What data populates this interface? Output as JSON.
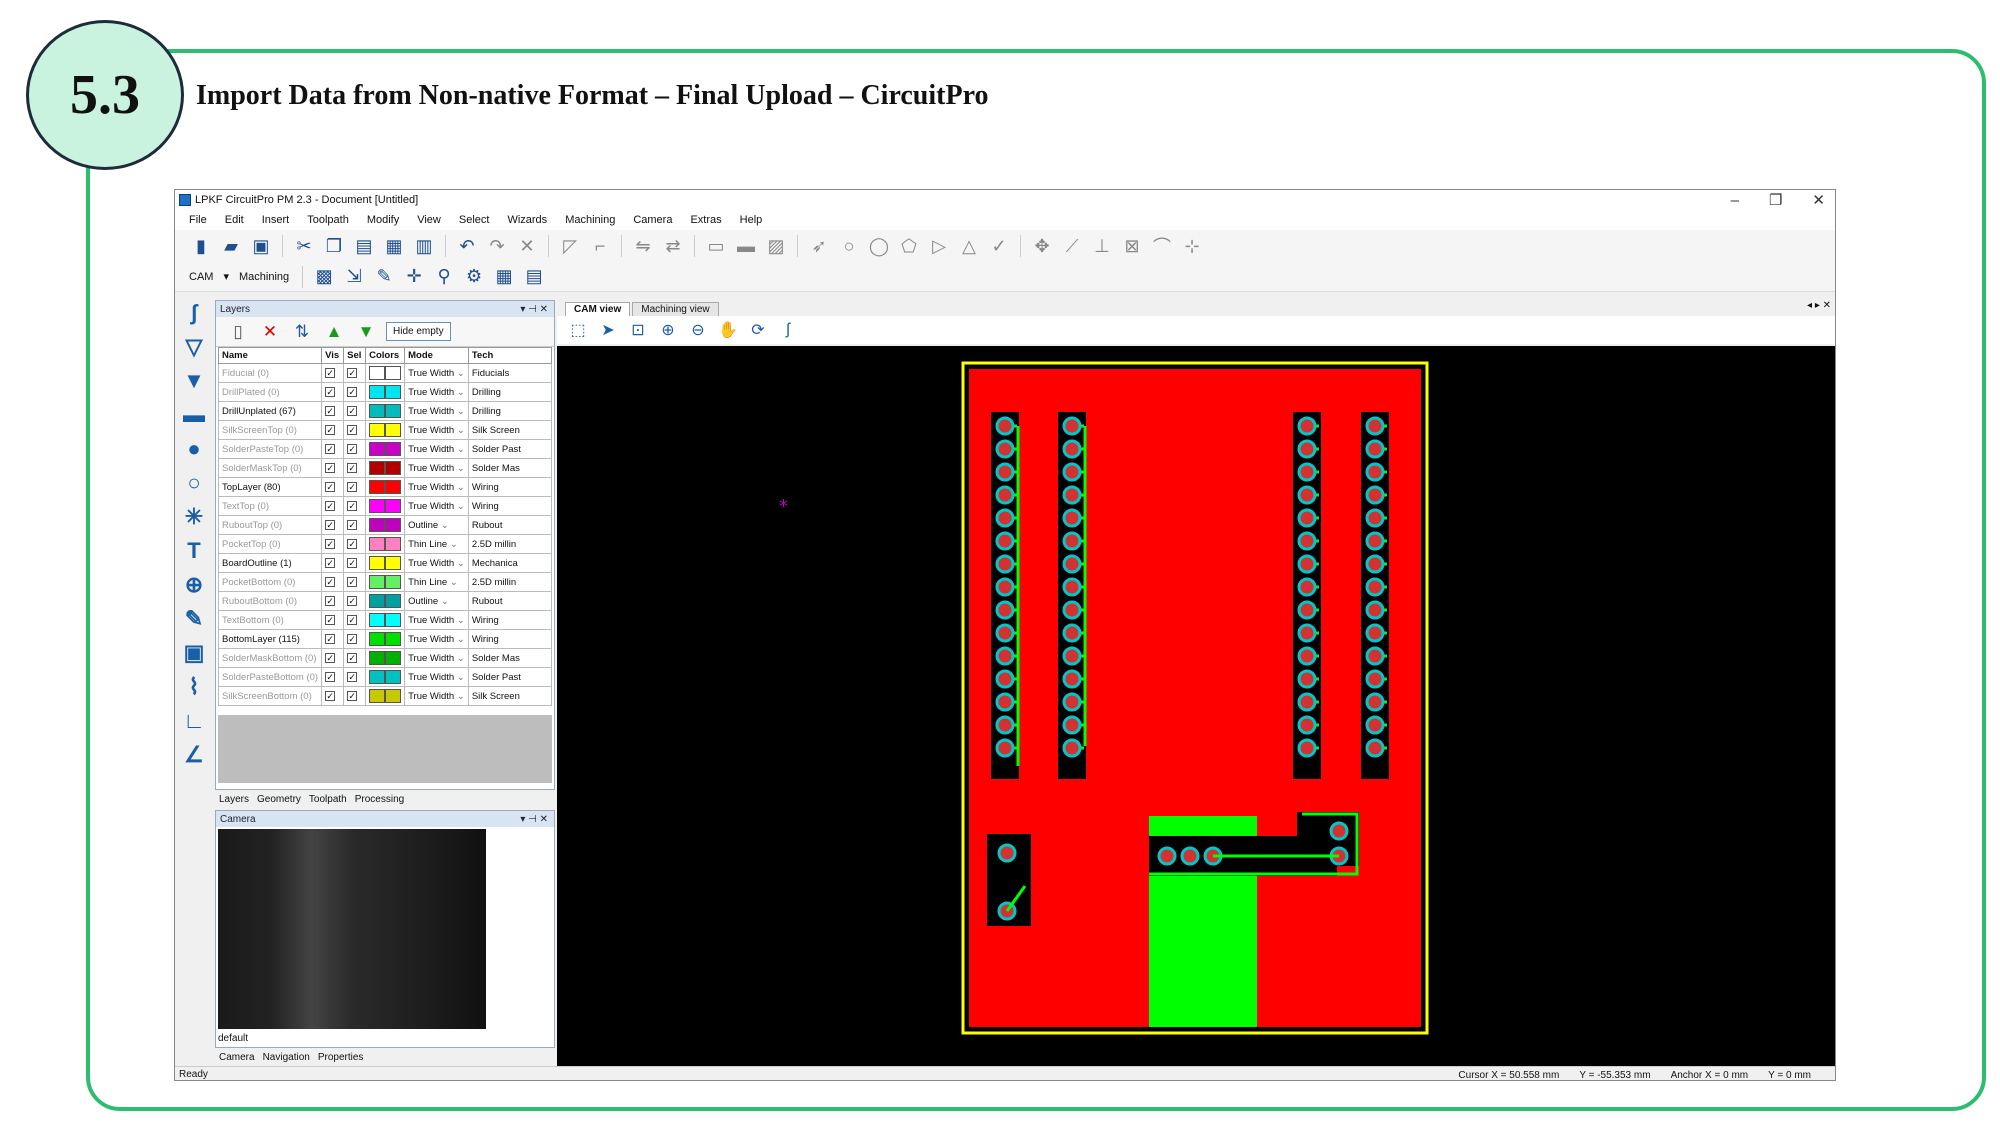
{
  "slide": {
    "badge": "5.3",
    "title": "Import Data from Non-native Format – Final Upload – CircuitPro"
  },
  "app": {
    "window_title": "LPKF CircuitPro PM 2.3 - Document [Untitled]",
    "menu": [
      "File",
      "Edit",
      "Insert",
      "Toolpath",
      "Modify",
      "View",
      "Select",
      "Wizards",
      "Machining",
      "Camera",
      "Extras",
      "Help"
    ],
    "toolbar2": {
      "mode_label": "CAM",
      "mode_value": "Machining"
    }
  },
  "layers_panel": {
    "title": "Layers",
    "hide_empty": "Hide empty",
    "columns": [
      "Name",
      "Vis",
      "Sel",
      "Colors",
      "Mode",
      "Tech"
    ],
    "rows": [
      {
        "name": "Fiducial (0)",
        "color": "#ffffff",
        "mode": "True Width",
        "tech": "Fiducials",
        "dim": true
      },
      {
        "name": "DrillPlated (0)",
        "color": "#00e5ee",
        "mode": "True Width",
        "tech": "Drilling",
        "dim": true
      },
      {
        "name": "DrillUnplated (67)",
        "color": "#00bcbc",
        "mode": "True Width",
        "tech": "Drilling",
        "dim": false
      },
      {
        "name": "SilkScreenTop (0)",
        "color": "#ffff00",
        "mode": "True Width",
        "tech": "Silk Screen",
        "dim": true
      },
      {
        "name": "SolderPasteTop (0)",
        "color": "#c800c8",
        "mode": "True Width",
        "tech": "Solder Past",
        "dim": true
      },
      {
        "name": "SolderMaskTop (0)",
        "color": "#b00000",
        "mode": "True Width",
        "tech": "Solder Mas",
        "dim": true
      },
      {
        "name": "TopLayer (80)",
        "color": "#ff0000",
        "mode": "True Width",
        "tech": "Wiring",
        "dim": false
      },
      {
        "name": "TextTop (0)",
        "color": "#ff00ff",
        "mode": "True Width",
        "tech": "Wiring",
        "dim": true
      },
      {
        "name": "RuboutTop (0)",
        "color": "#c000c0",
        "mode": "Outline",
        "tech": "Rubout",
        "dim": true
      },
      {
        "name": "PocketTop (0)",
        "color": "#ff80c0",
        "mode": "Thin Line",
        "tech": "2.5D millin",
        "dim": true
      },
      {
        "name": "BoardOutline (1)",
        "color": "#ffff00",
        "mode": "True Width",
        "tech": "Mechanica",
        "dim": false
      },
      {
        "name": "PocketBottom (0)",
        "color": "#66ee66",
        "mode": "Thin Line",
        "tech": "2.5D millin",
        "dim": true
      },
      {
        "name": "RuboutBottom (0)",
        "color": "#00a0a0",
        "mode": "Outline",
        "tech": "Rubout",
        "dim": true
      },
      {
        "name": "TextBottom (0)",
        "color": "#00ffff",
        "mode": "True Width",
        "tech": "Wiring",
        "dim": true
      },
      {
        "name": "BottomLayer (115)",
        "color": "#00e000",
        "mode": "True Width",
        "tech": "Wiring",
        "dim": false
      },
      {
        "name": "SolderMaskBottom (0)",
        "color": "#00b000",
        "mode": "True Width",
        "tech": "Solder Mas",
        "dim": true
      },
      {
        "name": "SolderPasteBottom (0)",
        "color": "#00c0c0",
        "mode": "True Width",
        "tech": "Solder Past",
        "dim": true
      },
      {
        "name": "SilkScreenBottom (0)",
        "color": "#c8c800",
        "mode": "True Width",
        "tech": "Silk Screen",
        "dim": true
      }
    ],
    "tabs": [
      "Layers",
      "Geometry",
      "Toolpath",
      "Processing"
    ]
  },
  "camera_panel": {
    "title": "Camera",
    "label": "default",
    "tabs": [
      "Camera",
      "Navigation",
      "Properties"
    ]
  },
  "cam_view": {
    "tabs": [
      "CAM view",
      "Machining view"
    ],
    "board_color": "#ff0000",
    "copper_color": "#00ff00"
  },
  "status": {
    "text": "Ready",
    "cursor_x_label": "Cursor X =",
    "cursor_x": "50.558 mm",
    "cursor_y_label": "Y =",
    "cursor_y": "-55.353 mm",
    "anchor_x_label": "Anchor X =",
    "anchor_x": "0 mm",
    "anchor_y_label": "Y =",
    "anchor_y": "0 mm"
  }
}
